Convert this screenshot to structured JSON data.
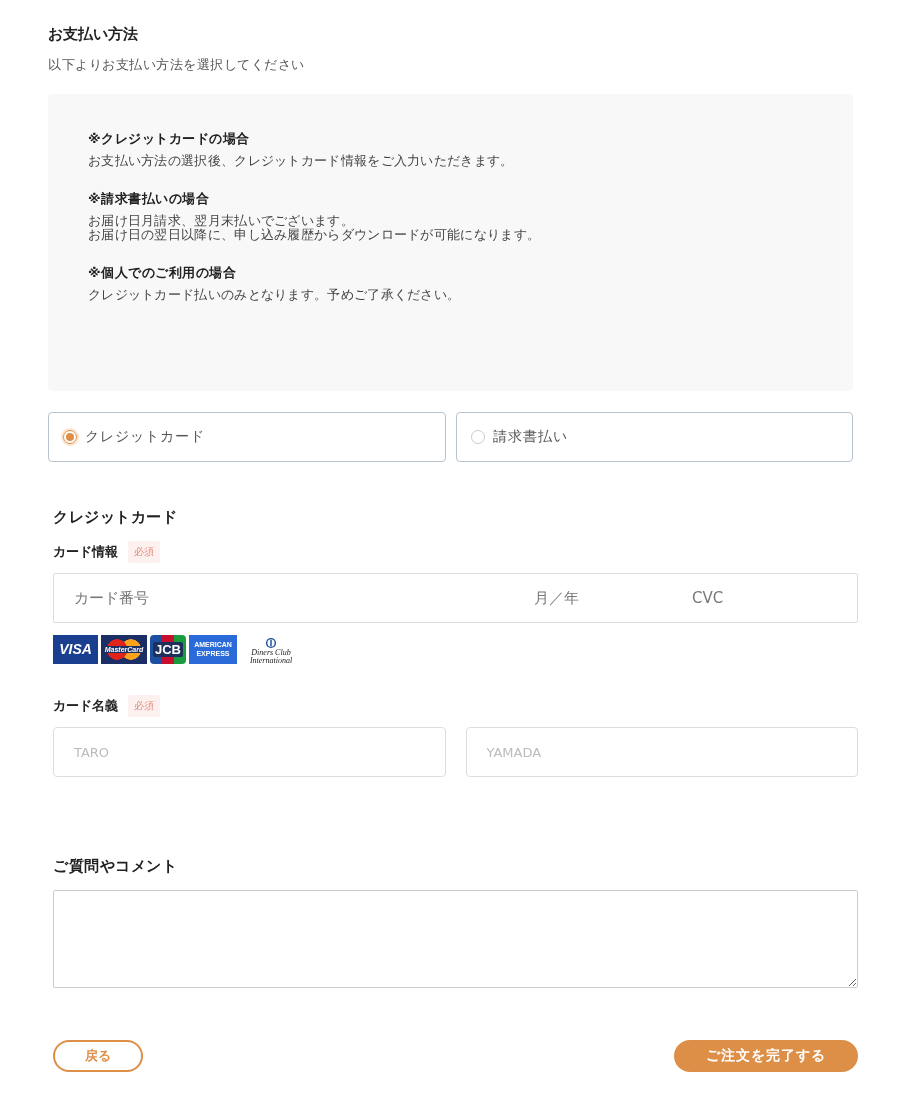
{
  "title": "お支払い方法",
  "subtitle": "以下よりお支払い方法を選択してください",
  "notes": [
    {
      "heading": "※クレジットカードの場合",
      "lines": [
        "お支払い方法の選択後、クレジットカード情報をご入力いただきます。"
      ]
    },
    {
      "heading": "※請求書払いの場合",
      "lines": [
        "お届け日月請求、翌月末払いでございます。",
        "お届け日の翌日以降に、申し込み履歴からダウンロードが可能になります。"
      ]
    },
    {
      "heading": "※個人でのご利用の場合",
      "lines": [
        "クレジットカード払いのみとなります。予めご了承ください。"
      ]
    }
  ],
  "payment_options": [
    {
      "label": "クレジットカード",
      "selected": true
    },
    {
      "label": "請求書払い",
      "selected": false
    }
  ],
  "card_section": {
    "title": "クレジットカード",
    "card_info": {
      "label": "カード情報",
      "badge": "必須",
      "fields": [
        {
          "placeholder": "カード番号"
        },
        {
          "placeholder": "月／年"
        },
        {
          "placeholder": "CVC"
        }
      ]
    },
    "brands": [
      {
        "kind": "visa",
        "text": "VISA"
      },
      {
        "kind": "mastercard",
        "text": "MasterCard"
      },
      {
        "kind": "jcb",
        "text": "JCB"
      },
      {
        "kind": "amex",
        "text": "AMERICAN EXPRESS"
      },
      {
        "kind": "diners",
        "text": "Diners Club International"
      }
    ],
    "card_name": {
      "label": "カード名義",
      "badge": "必須",
      "fields": [
        {
          "placeholder": "TARO"
        },
        {
          "placeholder": "YAMADA"
        }
      ]
    }
  },
  "comment": {
    "title": "ご質問やコメント"
  },
  "buttons": {
    "back": "戻る",
    "submit": "ご注文を完了する"
  }
}
